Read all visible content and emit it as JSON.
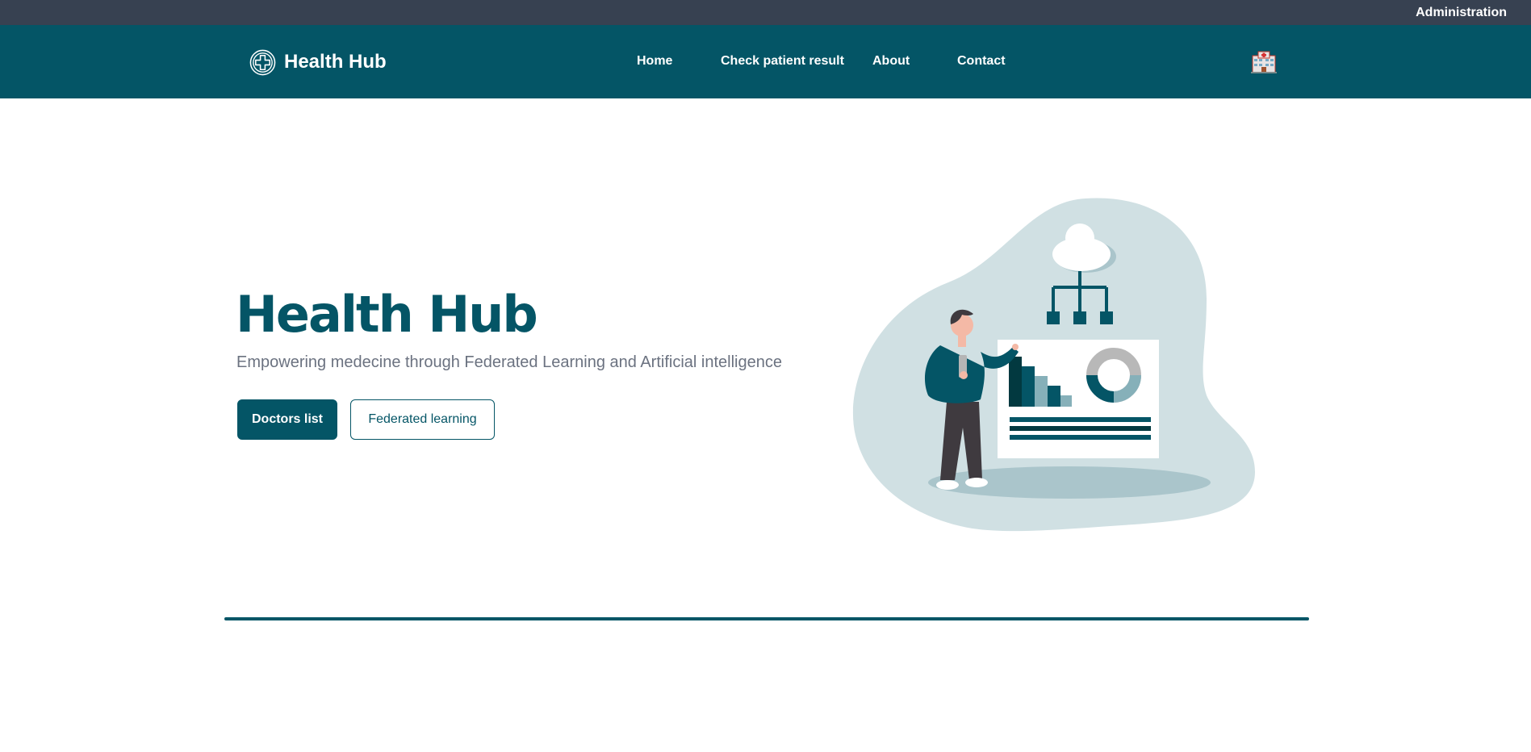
{
  "topbar": {
    "admin_link": "Administration"
  },
  "navbar": {
    "brand_name": "Health Hub",
    "links": [
      "Home",
      "Check patient result",
      "About",
      "Contact"
    ]
  },
  "hero": {
    "title": "Health Hub",
    "subtitle": "Empowering medecine through Federated Learning and Artificial intelligence",
    "primary_button": "Doctors list",
    "secondary_button": "Federated learning"
  },
  "icons": {
    "logo": "medical-cross-icon",
    "hospital": "hospital-icon",
    "illustration": "federated-learning-illustration"
  },
  "colors": {
    "brand": "#045566",
    "topbar": "#374151",
    "blob": "#d0e0e3",
    "subtitle": "#6b7280"
  }
}
